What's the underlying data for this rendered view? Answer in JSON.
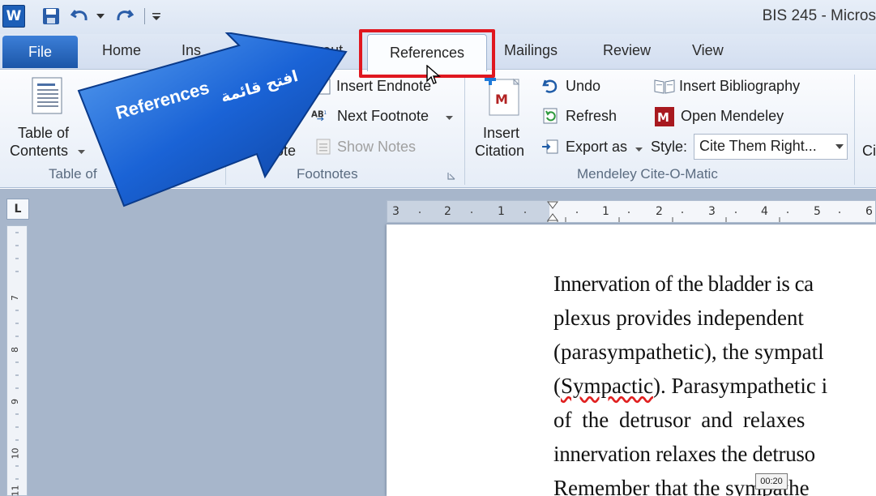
{
  "window": {
    "title": "BIS 245  -  Micros"
  },
  "tabs": {
    "file": "File",
    "home": "Home",
    "insert": "Ins",
    "page_layout": "Page Layout",
    "references": "References",
    "mailings": "Mailings",
    "review": "Review",
    "view": "View"
  },
  "ribbon": {
    "toc": {
      "label_line1": "Table of",
      "label_line2": "Contents",
      "group": "Table of"
    },
    "footnotes": {
      "insert_endnote": "Insert Endnote",
      "next_footnote": "Next Footnote",
      "show_notes": "Show Notes",
      "partial_label": "note",
      "group": "Footnotes"
    },
    "mendeley": {
      "insert_citation_line1": "Insert",
      "insert_citation_line2": "Citation",
      "undo": "Undo",
      "refresh": "Refresh",
      "export_as": "Export as",
      "insert_bibliography": "Insert Bibliography",
      "open_mendeley": "Open Mendeley",
      "style_label": "Style:",
      "style_value": "Cite Them Right...",
      "group": "Mendeley Cite-O-Matic"
    },
    "partial_right": "Ci"
  },
  "callout": {
    "english": "References",
    "arabic": "افتح قائمة"
  },
  "document": {
    "lines": [
      "Innervation of the bladder is ca",
      "plexus  provides  independent",
      "(parasympathetic), the sympatl",
      "(Sympactic). Parasympathetic i",
      "of  the  detrusor  and  relaxes",
      "innervation relaxes the detruso",
      "Remember  that  the  sympathe"
    ],
    "squiggle_word": "Sympactic"
  },
  "rulers": {
    "horizontal_ticks": [
      "3",
      "2",
      "1",
      "1",
      "2",
      "3",
      "4",
      "5",
      "6"
    ],
    "vertical_ticks": [
      "7",
      "8",
      "9",
      "10",
      "11"
    ]
  },
  "video": {
    "timestamp": "00:20"
  },
  "colors": {
    "accent": "#1c56a8",
    "highlight": "#e0171f",
    "callout": "#1a63d6"
  }
}
